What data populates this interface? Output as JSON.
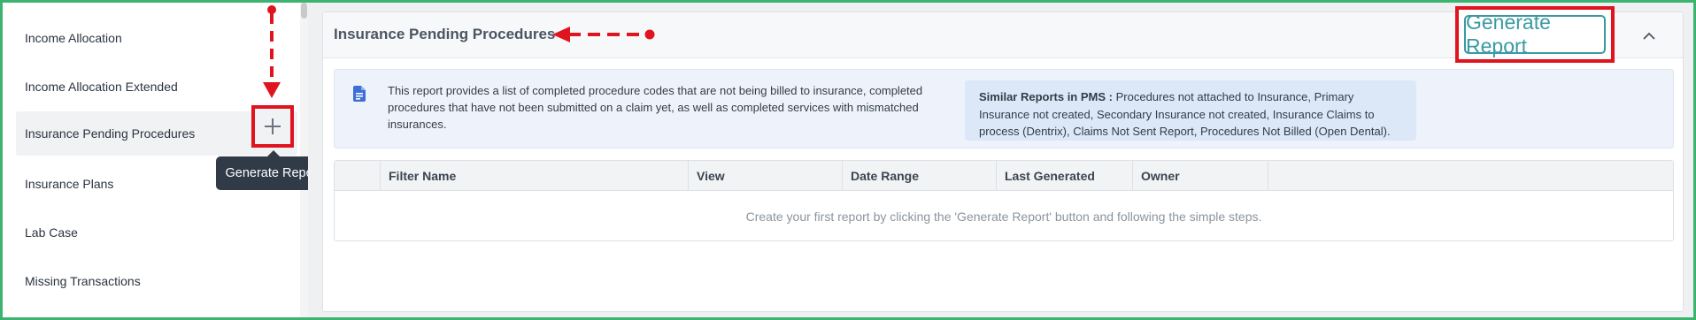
{
  "sidebar": {
    "items": [
      {
        "label": "Income Allocation"
      },
      {
        "label": "Income Allocation Extended"
      },
      {
        "label": "Insurance Pending Procedures"
      },
      {
        "label": "Insurance Plans"
      },
      {
        "label": "Lab Case"
      },
      {
        "label": "Missing Transactions"
      }
    ],
    "add_icon": "plus-icon",
    "tooltip": "Generate Report"
  },
  "card": {
    "title": "Insurance Pending Procedures",
    "generate_label": "Generate Report",
    "collapse_icon": "chevron-up-icon",
    "description": "This report provides a list of completed procedure codes that are not being billed to insurance, completed procedures that have not been submitted on a claim yet, as well as completed services with mismatched insurances.",
    "similar_label": "Similar Reports in PMS :",
    "similar_text": "Procedures not attached to Insurance, Primary Insurance not created, Secondary Insurance not created, Insurance Claims to process (Dentrix), Claims Not Sent Report, Procedures Not Billed (Open Dental).",
    "info_icon": "document-icon"
  },
  "table": {
    "columns": [
      "",
      "Filter Name",
      "View",
      "Date Range",
      "Last Generated",
      "Owner",
      ""
    ],
    "empty_message": "Create your first report by clicking the 'Generate Report' button and following the simple steps."
  },
  "colors": {
    "accent": "#3a9aa2",
    "annotation": "#e0141e",
    "frame": "#3cb371",
    "tooltip_bg": "#303b47"
  }
}
